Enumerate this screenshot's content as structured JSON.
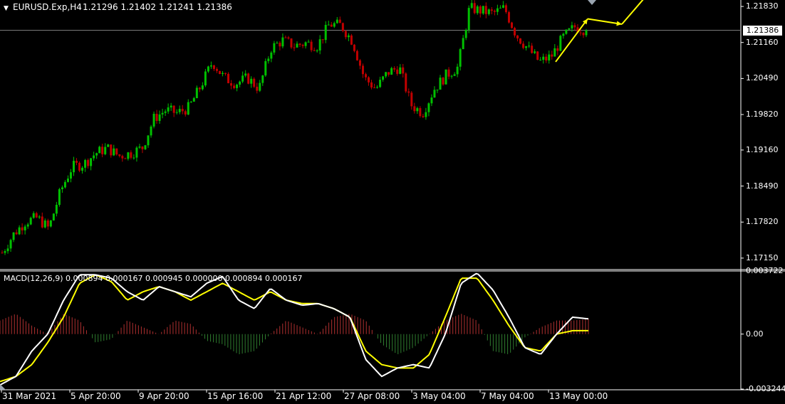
{
  "header": {
    "symbol_timeframe": "EURUSD.Exp,H4",
    "ohlc": "1.21296 1.21402 1.21241 1.21386"
  },
  "price_axis": {
    "ticks": [
      "1.21830",
      "1.21160",
      "1.20490",
      "1.19820",
      "1.19160",
      "1.18490",
      "1.17820",
      "1.17150"
    ],
    "current_price": "1.21386"
  },
  "macd_panel": {
    "label": "MACD(12,26,9) 0.000894 0.000167 0.000945 0.000000 0.000894 0.000167",
    "ticks": [
      "0.003722",
      "0.00",
      "-0.003244"
    ]
  },
  "time_axis": {
    "labels": [
      "31 Mar 2021",
      "5 Apr 20:00",
      "9 Apr 20:00",
      "15 Apr 16:00",
      "21 Apr 12:00",
      "27 Apr 08:00",
      "3 May 04:00",
      "7 May 04:00",
      "13 May 00:00"
    ]
  },
  "colors": {
    "background": "#000000",
    "bull": "#00c000",
    "bear": "#c00000",
    "macd_line": "#ffffff",
    "signal_line": "#ffff00",
    "hist_pos": "#b03030",
    "hist_neg": "#2f7d2f",
    "grid_line": "#808080",
    "arrow": "#ffff00"
  },
  "chart_data": [
    {
      "type": "candlestick",
      "title": "EURUSD.Exp,H4",
      "ylim": [
        1.1695,
        1.2195
      ],
      "x": [
        "31 Mar 2021",
        "5 Apr 20:00",
        "9 Apr 20:00",
        "15 Apr 16:00",
        "21 Apr 12:00",
        "27 Apr 08:00",
        "3 May 04:00",
        "7 May 04:00",
        "13 May 00:00"
      ],
      "close_path": [
        1.1725,
        1.176,
        1.1783,
        1.179,
        1.177,
        1.184,
        1.1885,
        1.189,
        1.191,
        1.192,
        1.1905,
        1.191,
        1.192,
        1.1975,
        1.199,
        1.1985,
        1.1995,
        1.2035,
        1.208,
        1.205,
        1.204,
        1.205,
        1.203,
        1.2105,
        1.212,
        1.211,
        1.2115,
        1.211,
        1.215,
        1.2148,
        1.2118,
        1.205,
        1.203,
        1.206,
        1.207,
        1.2,
        1.1985,
        1.203,
        1.2055,
        1.207,
        1.218,
        1.2175,
        1.217,
        1.218,
        1.213,
        1.2105,
        1.208,
        1.209,
        1.2125,
        1.2145,
        1.2139
      ],
      "last_close": 1.21386,
      "projection": [
        [
          1.208,
          1.216
        ],
        [
          1.216,
          1.215
        ],
        [
          1.215,
          1.223
        ]
      ]
    },
    {
      "type": "line",
      "title": "MACD(12,26,9)",
      "ylim": [
        -0.003244,
        0.003722
      ],
      "series": [
        {
          "name": "MACD",
          "values": [
            -0.003,
            -0.0025,
            -0.001,
            0.0,
            0.002,
            0.0035,
            0.0035,
            0.0033,
            0.0025,
            0.002,
            0.0028,
            0.0025,
            0.0022,
            0.003,
            0.0034,
            0.002,
            0.0015,
            0.0027,
            0.002,
            0.0017,
            0.0018,
            0.0015,
            0.001,
            -0.0015,
            -0.0025,
            -0.002,
            -0.0018,
            -0.002,
            0.0,
            0.003,
            0.0036,
            0.0026,
            0.001,
            -0.0008,
            -0.0012,
            0.0,
            0.001,
            0.0009
          ]
        },
        {
          "name": "Signal",
          "values": [
            -0.0028,
            -0.0025,
            -0.0018,
            -0.0005,
            0.001,
            0.003,
            0.0035,
            0.0031,
            0.002,
            0.0025,
            0.0028,
            0.0025,
            0.002,
            0.0025,
            0.003,
            0.0025,
            0.002,
            0.0025,
            0.002,
            0.0018,
            0.0018,
            0.0015,
            0.001,
            -0.001,
            -0.0018,
            -0.002,
            -0.002,
            -0.0012,
            0.001,
            0.0033,
            0.0033,
            0.002,
            0.0005,
            -0.0008,
            -0.001,
            0.0,
            0.0002,
            0.0002
          ]
        },
        {
          "name": "Histogram",
          "values": [
            0.0008,
            0.0012,
            0.0005,
            0.0,
            0.0012,
            0.0008,
            -0.0005,
            -0.0003,
            0.0008,
            0.0004,
            0.0,
            0.0008,
            0.0006,
            -0.0004,
            -0.0006,
            -0.0012,
            -0.001,
            0.0,
            0.0008,
            0.0004,
            0.0,
            0.001,
            0.0012,
            0.0008,
            -0.0006,
            -0.0012,
            -0.0008,
            0.0,
            0.0008,
            0.0012,
            0.0008,
            -0.001,
            -0.0012,
            -0.0002,
            0.0004,
            0.0008,
            0.0008,
            0.0009
          ]
        }
      ]
    }
  ]
}
